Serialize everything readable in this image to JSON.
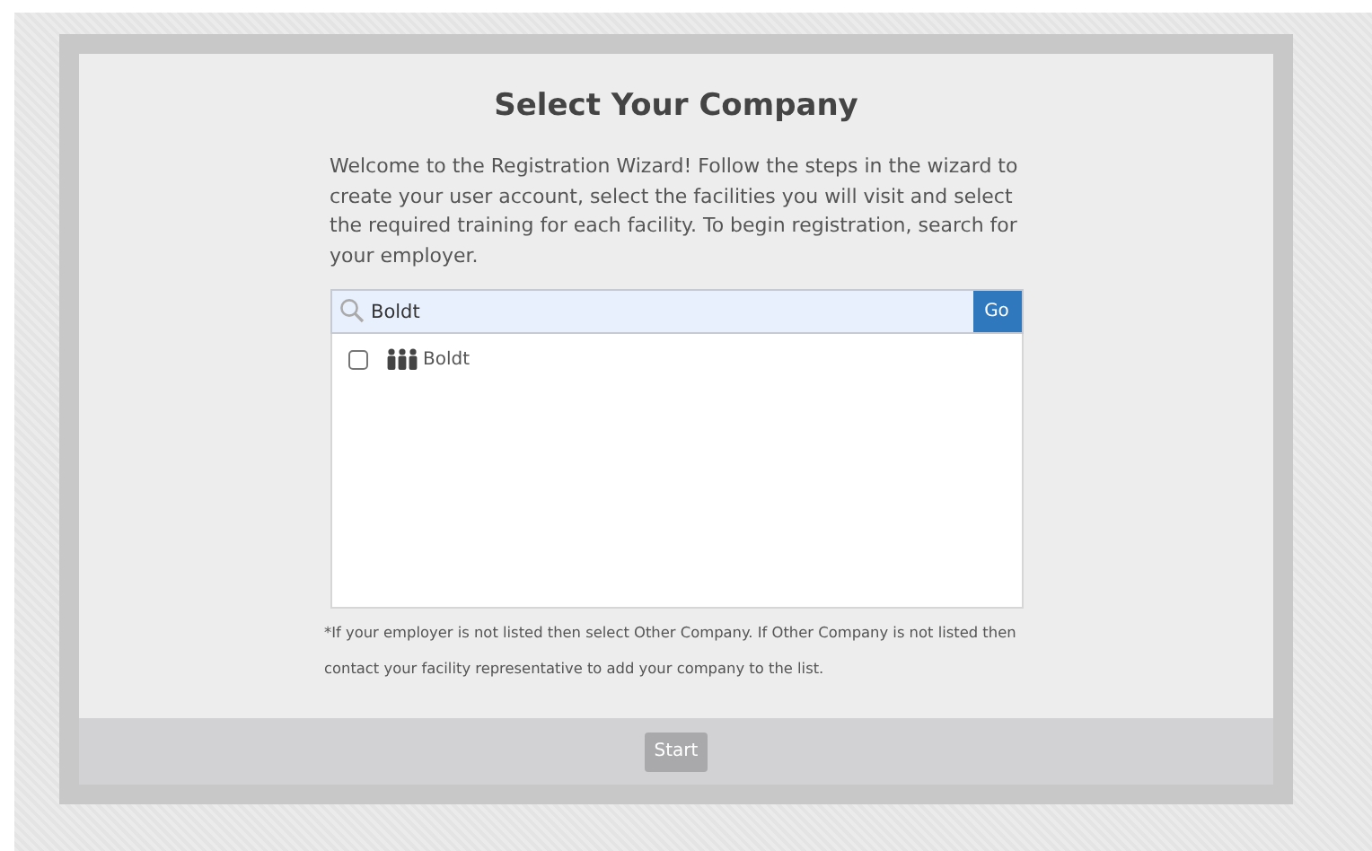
{
  "title": "Select Your Company",
  "intro": "Welcome to the Registration Wizard! Follow the steps in the wizard to create your user account, select the facilities you will visit and select the required training for each facility. To begin registration, search for your employer.",
  "search": {
    "value": "Boldt",
    "button": "Go"
  },
  "companies": [
    {
      "name": "Boldt",
      "checked": false
    }
  ],
  "note": "*If your employer is not listed then select Other Company. If Other Company is not listed then contact your facility representative to add your company to the list.",
  "start_button": {
    "label": "Start",
    "disabled": true
  }
}
